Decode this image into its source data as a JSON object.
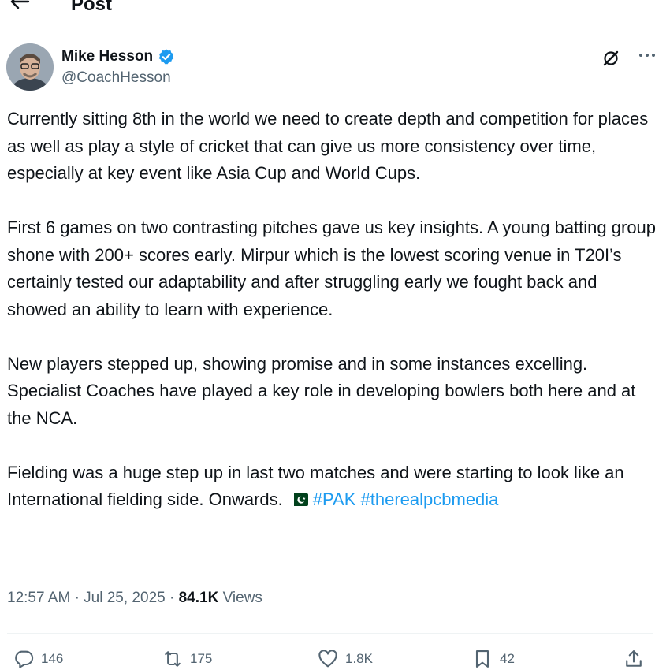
{
  "header": {
    "title": "Post"
  },
  "author": {
    "display_name": "Mike Hesson",
    "handle": "@CoachHesson"
  },
  "post": {
    "paragraphs": [
      "Currently sitting 8th in the world we need to create depth and competition for places as well as play a style of cricket that can give us more consistency over time, especially at key event like Asia Cup and World Cups.",
      "First 6 games on two contrasting pitches gave us key insights. A young batting group shone with 200+ scores early. Mirpur which is the lowest scoring venue in T20I’s certainly tested our adaptability and after struggling early we fought back and showed an ability to learn with experience.",
      "New players stepped up, showing promise and in some instances excelling. Specialist Coaches have played a key role in developing bowlers both here and at the NCA.",
      "Fielding was a huge step up in last two matches and were starting to look like an International fielding side. Onwards."
    ],
    "hashtags": [
      "#PAK",
      "#therealpcbmedia"
    ]
  },
  "meta": {
    "time": "12:57 AM",
    "separator": "·",
    "date": "Jul 25, 2025",
    "views_count": "84.1K",
    "views_label": "Views"
  },
  "actions": {
    "replies": "146",
    "reposts": "175",
    "likes": "1.8K",
    "bookmarks": "42"
  },
  "colors": {
    "text": "#0f1419",
    "secondary": "#536471",
    "link": "#1d9bf0",
    "verified": "#1d9bf0",
    "divider": "#eff3f4"
  },
  "icons": [
    "back-arrow-icon",
    "verified-icon",
    "grok-icon",
    "more-icon",
    "pakistan-flag-icon",
    "reply-icon",
    "repost-icon",
    "like-icon",
    "bookmark-icon",
    "share-icon"
  ]
}
